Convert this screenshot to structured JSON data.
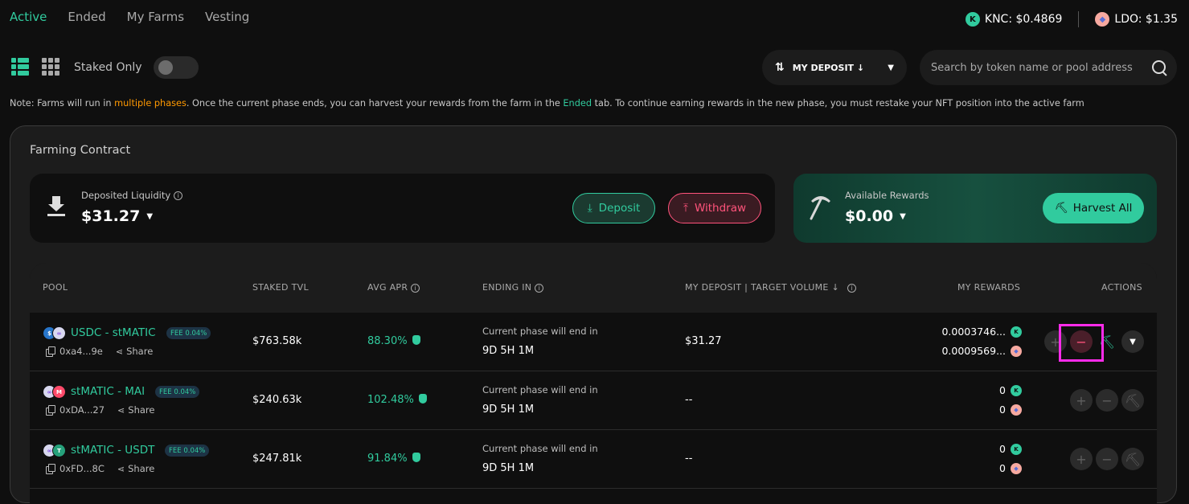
{
  "tabs": [
    {
      "label": "Active"
    },
    {
      "label": "Ended"
    },
    {
      "label": "My Farms"
    },
    {
      "label": "Vesting"
    }
  ],
  "prices": {
    "knc": "KNC: $0.4869",
    "ldo": "LDO: $1.35"
  },
  "toolbar": {
    "staked_only_label": "Staked Only",
    "sort_label": "MY DEPOSIT ↓",
    "search_placeholder": "Search by token name or pool address"
  },
  "note": {
    "part1": "Note: Farms will run in ",
    "highlight1": "multiple phases",
    "part2": ". Once the current phase ends, you can harvest your rewards from the farm in the ",
    "highlight2": "Ended",
    "part3": " tab. To continue earning rewards in the new phase, you must restake your NFT position into the active farm"
  },
  "contract": {
    "title": "Farming Contract",
    "deposited_label": "Deposited Liquidity",
    "deposited_value": "$31.27",
    "deposit_button": "Deposit",
    "withdraw_button": "Withdraw",
    "rewards_label": "Available Rewards",
    "rewards_value": "$0.00",
    "harvest_button": "Harvest All"
  },
  "table": {
    "headers": {
      "pool": "POOL",
      "tvl": "STAKED TVL",
      "apr": "AVG APR",
      "ending": "ENDING IN",
      "deposit": "MY DEPOSIT | TARGET VOLUME ↓",
      "rewards": "MY REWARDS",
      "actions": "ACTIONS"
    },
    "rows": [
      {
        "pool": "USDC - stMATIC",
        "fee": "FEE 0.04%",
        "address": "0xa4...9e",
        "share": "Share",
        "tvl": "$763.58k",
        "apr": "88.30%",
        "ending_label": "Current phase will end in",
        "ending_value": "9D 5H 1M",
        "deposit": "$31.27",
        "reward_knc": "0.0003746...",
        "reward_ldo": "0.0009569..."
      },
      {
        "pool": "stMATIC - MAI",
        "fee": "FEE 0.04%",
        "address": "0xDA...27",
        "share": "Share",
        "tvl": "$240.63k",
        "apr": "102.48%",
        "ending_label": "Current phase will end in",
        "ending_value": "9D 5H 1M",
        "deposit": "--",
        "reward_knc": "0",
        "reward_ldo": "0"
      },
      {
        "pool": "stMATIC - USDT",
        "fee": "FEE 0.04%",
        "address": "0xFD...8C",
        "share": "Share",
        "tvl": "$247.81k",
        "apr": "91.84%",
        "ending_label": "Current phase will end in",
        "ending_value": "9D 5H 1M",
        "deposit": "--",
        "reward_knc": "0",
        "reward_ldo": "0"
      }
    ]
  },
  "colors": {
    "accent": "#31cb9e",
    "danger": "#ff537b",
    "warning": "#ff9901",
    "highlight_box": "#ff2bea"
  }
}
